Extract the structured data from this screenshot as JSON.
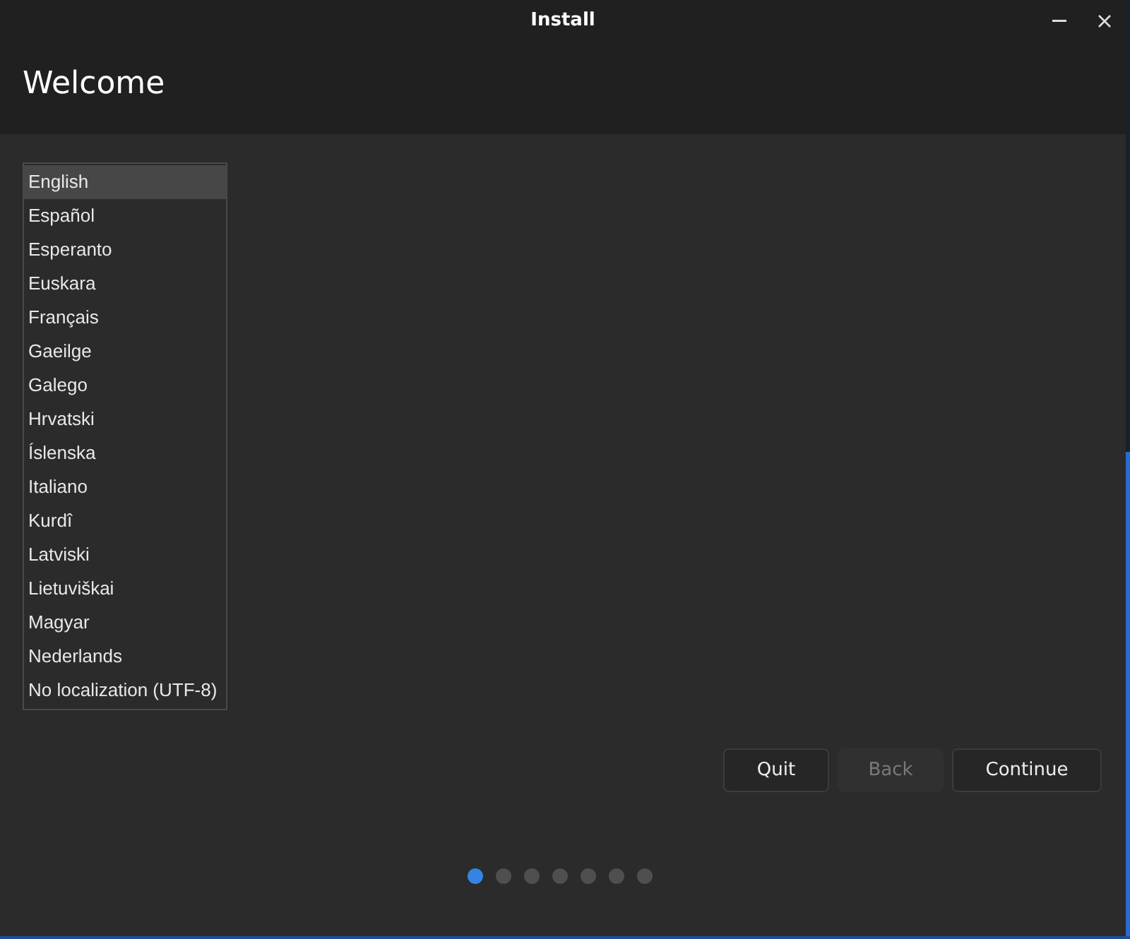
{
  "window": {
    "title": "Install"
  },
  "header": {
    "title": "Welcome"
  },
  "languages": [
    {
      "label": "English",
      "selected": true
    },
    {
      "label": "Español",
      "selected": false
    },
    {
      "label": "Esperanto",
      "selected": false
    },
    {
      "label": "Euskara",
      "selected": false
    },
    {
      "label": "Français",
      "selected": false
    },
    {
      "label": "Gaeilge",
      "selected": false
    },
    {
      "label": "Galego",
      "selected": false
    },
    {
      "label": "Hrvatski",
      "selected": false
    },
    {
      "label": "Íslenska",
      "selected": false
    },
    {
      "label": "Italiano",
      "selected": false
    },
    {
      "label": "Kurdî",
      "selected": false
    },
    {
      "label": "Latviski",
      "selected": false
    },
    {
      "label": "Lietuviškai",
      "selected": false
    },
    {
      "label": "Magyar",
      "selected": false
    },
    {
      "label": "Nederlands",
      "selected": false
    },
    {
      "label": "No localization (UTF-8)",
      "selected": false
    }
  ],
  "buttons": [
    {
      "label": "Quit",
      "disabled": false
    },
    {
      "label": "Back",
      "disabled": true
    },
    {
      "label": "Continue",
      "disabled": false
    }
  ],
  "steps": [
    {
      "selected": true
    },
    {
      "selected": false
    },
    {
      "selected": false
    },
    {
      "selected": false
    },
    {
      "selected": false
    },
    {
      "selected": false
    },
    {
      "selected": false
    }
  ]
}
